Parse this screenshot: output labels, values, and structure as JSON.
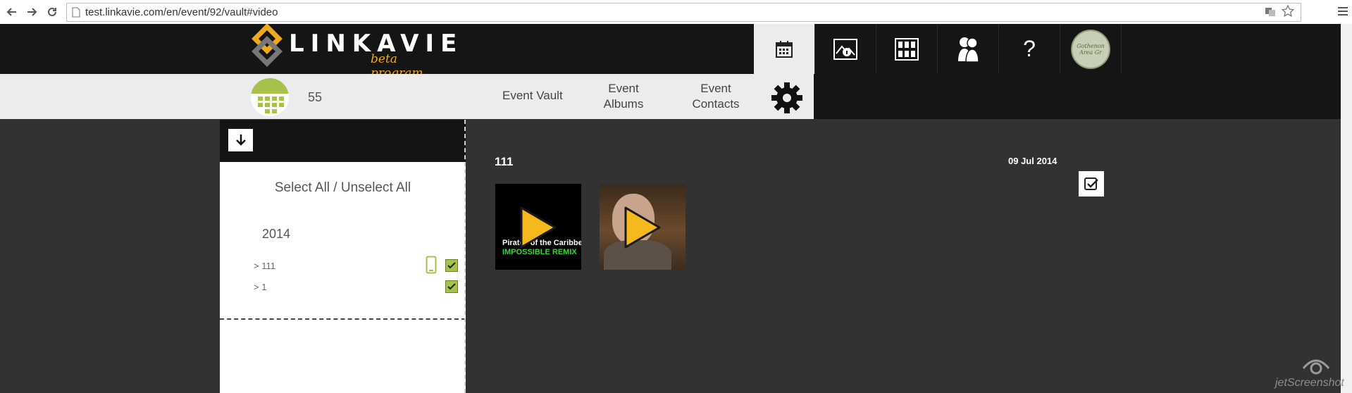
{
  "browser": {
    "url": "test.linkavie.com/en/event/92/vault#video"
  },
  "brand": {
    "name": "LINKAVIE",
    "tagline": "beta program",
    "accent_color": "#f0a81c"
  },
  "top_nav": {
    "help_label": "?",
    "avatar_text": "Gothenon Area Gr"
  },
  "subnav": {
    "count": "55",
    "event_vault": "Event Vault",
    "event_albums_line1": "Event",
    "event_albums_line2": "Albums",
    "event_contacts_line1": "Event",
    "event_contacts_line2": "Contacts"
  },
  "sidebar": {
    "select_all": "Select All",
    "separator": "/",
    "unselect_all": "Unselect All",
    "year": "2014",
    "items": [
      {
        "label": "> 111",
        "has_mobile_icon": true,
        "checked": true
      },
      {
        "label": "> 1",
        "has_mobile_icon": false,
        "checked": true
      }
    ]
  },
  "content": {
    "album_title": "111",
    "date": "09 Jul 2014",
    "videos": [
      {
        "caption_line1": "Pirates of the Caribbean",
        "caption_line2": "IMPOSSIBLE REMIX"
      },
      {
        "caption_line1": "",
        "caption_line2": ""
      }
    ]
  },
  "watermark": {
    "text": "jetScreenshot"
  },
  "colors": {
    "header_bg": "#151515",
    "content_bg": "#323232",
    "green_accent": "#a7c24b",
    "play_yellow": "#f6b91d"
  }
}
